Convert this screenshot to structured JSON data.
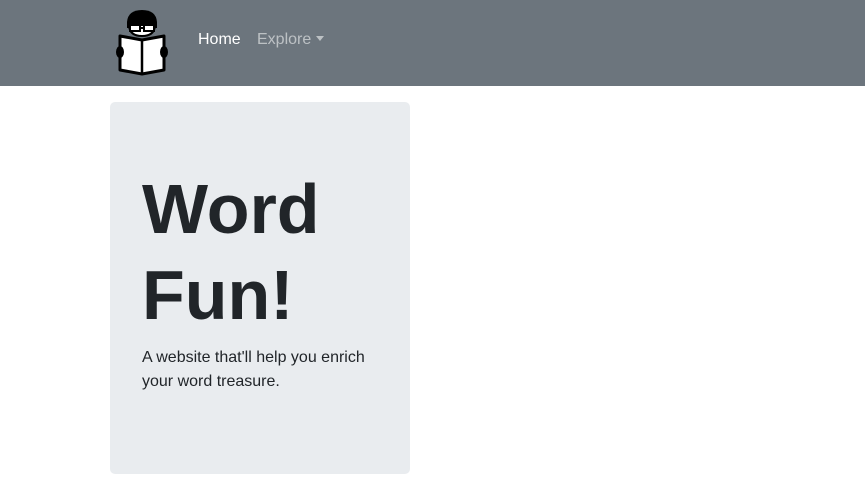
{
  "navbar": {
    "logo_icon": "reader-with-book-icon",
    "home_label": "Home",
    "explore_label": "Explore",
    "background_color": "#6c757d"
  },
  "hero": {
    "title_line1": "Word",
    "title_line2": "Fun!",
    "lead": "A website that'll help you enrich your word treasure.",
    "background_color": "#e9ecef"
  }
}
